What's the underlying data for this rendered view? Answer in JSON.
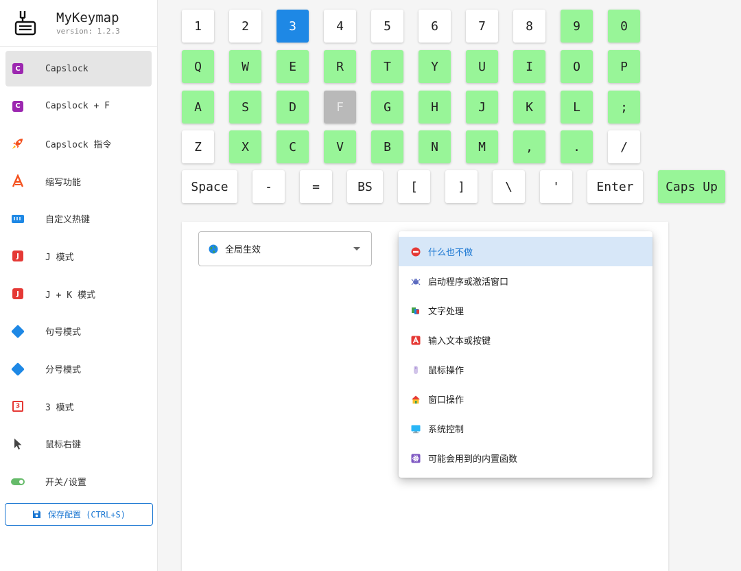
{
  "app": {
    "title": "MyKeymap",
    "version": "version: 1.2.3"
  },
  "sidebar": {
    "items": [
      {
        "label": "Capslock",
        "icon": "capslock-c-icon"
      },
      {
        "label": "Capslock + F",
        "icon": "capslock-c-icon"
      },
      {
        "label": "Capslock 指令",
        "icon": "rocket-icon"
      },
      {
        "label": "缩写功能",
        "icon": "abbreviation-a-icon"
      },
      {
        "label": "自定义热键",
        "icon": "keyboard-icon"
      },
      {
        "label": "J 模式",
        "icon": "j-icon"
      },
      {
        "label": "J + K 模式",
        "icon": "j-icon"
      },
      {
        "label": "句号模式",
        "icon": "diamond-icon"
      },
      {
        "label": "分号模式",
        "icon": "diamond-icon"
      },
      {
        "label": "3 模式",
        "icon": "three-icon"
      },
      {
        "label": "鼠标右键",
        "icon": "cursor-icon"
      },
      {
        "label": "开关/设置",
        "icon": "toggle-icon"
      }
    ],
    "active_index": 0,
    "save_label": "保存配置 (CTRL+S)"
  },
  "keyboard": {
    "rows": [
      {
        "keys": [
          {
            "label": "1",
            "state": "normal"
          },
          {
            "label": "2",
            "state": "normal"
          },
          {
            "label": "3",
            "state": "selected"
          },
          {
            "label": "4",
            "state": "normal"
          },
          {
            "label": "5",
            "state": "normal"
          },
          {
            "label": "6",
            "state": "normal"
          },
          {
            "label": "7",
            "state": "normal"
          },
          {
            "label": "8",
            "state": "normal"
          },
          {
            "label": "9",
            "state": "mapped"
          },
          {
            "label": "0",
            "state": "mapped"
          }
        ]
      },
      {
        "keys": [
          {
            "label": "Q",
            "state": "mapped"
          },
          {
            "label": "W",
            "state": "mapped"
          },
          {
            "label": "E",
            "state": "mapped"
          },
          {
            "label": "R",
            "state": "mapped"
          },
          {
            "label": "T",
            "state": "mapped"
          },
          {
            "label": "Y",
            "state": "mapped"
          },
          {
            "label": "U",
            "state": "mapped"
          },
          {
            "label": "I",
            "state": "mapped"
          },
          {
            "label": "O",
            "state": "mapped"
          },
          {
            "label": "P",
            "state": "mapped"
          }
        ]
      },
      {
        "keys": [
          {
            "label": "A",
            "state": "mapped"
          },
          {
            "label": "S",
            "state": "mapped"
          },
          {
            "label": "D",
            "state": "mapped"
          },
          {
            "label": "F",
            "state": "disabled"
          },
          {
            "label": "G",
            "state": "mapped"
          },
          {
            "label": "H",
            "state": "mapped"
          },
          {
            "label": "J",
            "state": "mapped"
          },
          {
            "label": "K",
            "state": "mapped"
          },
          {
            "label": "L",
            "state": "mapped"
          },
          {
            "label": ";",
            "state": "mapped"
          }
        ]
      },
      {
        "keys": [
          {
            "label": "Z",
            "state": "normal"
          },
          {
            "label": "X",
            "state": "mapped"
          },
          {
            "label": "C",
            "state": "mapped"
          },
          {
            "label": "V",
            "state": "mapped"
          },
          {
            "label": "B",
            "state": "mapped"
          },
          {
            "label": "N",
            "state": "mapped"
          },
          {
            "label": "M",
            "state": "mapped"
          },
          {
            "label": ",",
            "state": "mapped"
          },
          {
            "label": ".",
            "state": "mapped"
          },
          {
            "label": "/",
            "state": "normal"
          }
        ]
      },
      {
        "keys": [
          {
            "label": "Space",
            "state": "normal"
          },
          {
            "label": "-",
            "state": "normal"
          },
          {
            "label": "=",
            "state": "normal"
          },
          {
            "label": "BS",
            "state": "normal"
          },
          {
            "label": "[",
            "state": "normal"
          },
          {
            "label": "]",
            "state": "normal"
          },
          {
            "label": "\\",
            "state": "normal"
          },
          {
            "label": "'",
            "state": "normal"
          },
          {
            "label": "Enter",
            "state": "normal"
          },
          {
            "label": "Caps Up",
            "state": "mapped"
          }
        ]
      }
    ]
  },
  "scope_select": {
    "value": "全局生效",
    "icon": "globe-icon"
  },
  "action_menu": {
    "items": [
      {
        "label": "什么也不做",
        "icon": "no-entry-icon",
        "selected": true
      },
      {
        "label": "启动程序或激活窗口",
        "icon": "bug-robot-icon"
      },
      {
        "label": "文字处理",
        "icon": "text-blocks-icon"
      },
      {
        "label": "输入文本或按键",
        "icon": "letter-a-icon"
      },
      {
        "label": "鼠标操作",
        "icon": "mouse-icon"
      },
      {
        "label": "窗口操作",
        "icon": "house-icon"
      },
      {
        "label": "系统控制",
        "icon": "monitor-icon"
      },
      {
        "label": "可能会用到的内置函数",
        "icon": "atom-icon"
      }
    ]
  },
  "colors": {
    "mapped_key": "#98f598",
    "selected_key": "#1e88e5",
    "disabled_key": "#b9b9b9",
    "accent": "#1976d2"
  }
}
